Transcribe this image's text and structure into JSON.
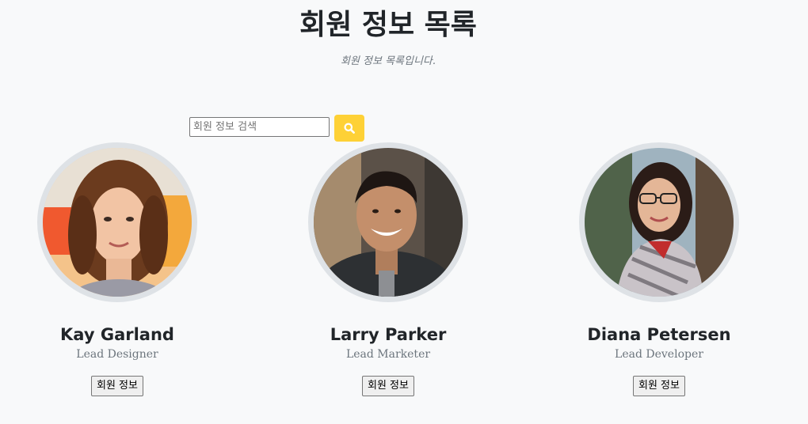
{
  "header": {
    "title": "회원 정보 목록",
    "subtitle": "회원 정보 목록입니다."
  },
  "search": {
    "placeholder": "회원 정보 검색",
    "value": "",
    "button_icon": "search-icon",
    "button_color": "#fed136"
  },
  "members": [
    {
      "name": "Kay Garland",
      "role": "Lead Designer",
      "button_label": "회원 정보",
      "photo": "woman-curly-hair-photo"
    },
    {
      "name": "Larry Parker",
      "role": "Lead Marketer",
      "button_label": "회원 정보",
      "photo": "man-smiling-photo"
    },
    {
      "name": "Diana Petersen",
      "role": "Lead Developer",
      "button_label": "회원 정보",
      "photo": "woman-glasses-photo"
    }
  ],
  "colors": {
    "background": "#f8f9fa",
    "accent": "#fed136",
    "avatar_border": "#dee2e6",
    "text_muted": "#6c757d"
  }
}
